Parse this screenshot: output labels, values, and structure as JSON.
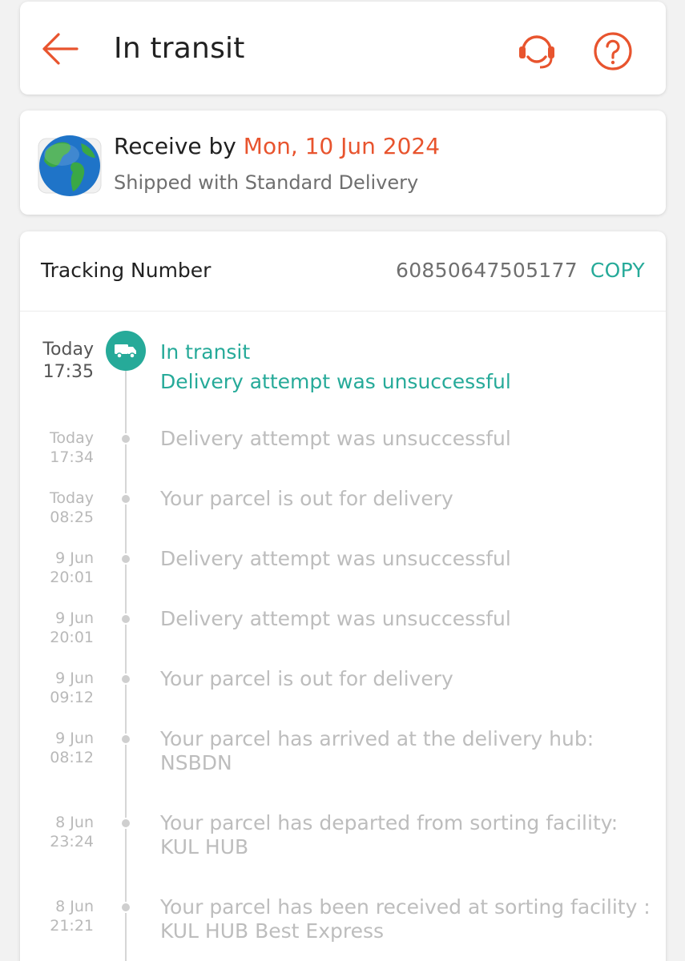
{
  "header": {
    "title": "In transit",
    "accent_color": "#e8542e",
    "icons": [
      "back-arrow-icon",
      "headset-icon",
      "help-icon"
    ]
  },
  "delivery": {
    "receive_prefix": "Receive by",
    "receive_date": "Mon, 10 Jun 2024",
    "shipped_with": "Shipped with Standard Delivery",
    "icon": "globe-icon"
  },
  "tracking": {
    "label": "Tracking Number",
    "number": "60850647505177",
    "copy_label": "COPY",
    "accent_color": "#26aa99"
  },
  "current_event": {
    "day": "Today",
    "time": "17:35",
    "status": "In transit",
    "detail": "Delivery attempt was unsuccessful",
    "icon": "truck-icon"
  },
  "events": [
    {
      "day": "Today",
      "time": "17:34",
      "description": "Delivery attempt was unsuccessful"
    },
    {
      "day": "Today",
      "time": "08:25",
      "description": "Your parcel is out for delivery"
    },
    {
      "day": "9 Jun",
      "time": "20:01",
      "description": "Delivery attempt was unsuccessful"
    },
    {
      "day": "9 Jun",
      "time": "20:01",
      "description": "Delivery attempt was unsuccessful"
    },
    {
      "day": "9 Jun",
      "time": "09:12",
      "description": "Your parcel is out for delivery"
    },
    {
      "day": "9 Jun",
      "time": "08:12",
      "description": "Your parcel has arrived at the delivery hub:",
      "location": "NSBDN"
    },
    {
      "day": "8 Jun",
      "time": "23:24",
      "description": "Your parcel has departed from sorting facility:",
      "location": "KUL HUB"
    },
    {
      "day": "8 Jun",
      "time": "21:21",
      "description": "Your parcel has been received at sorting facility :",
      "location": "KUL HUB Best Express"
    }
  ]
}
